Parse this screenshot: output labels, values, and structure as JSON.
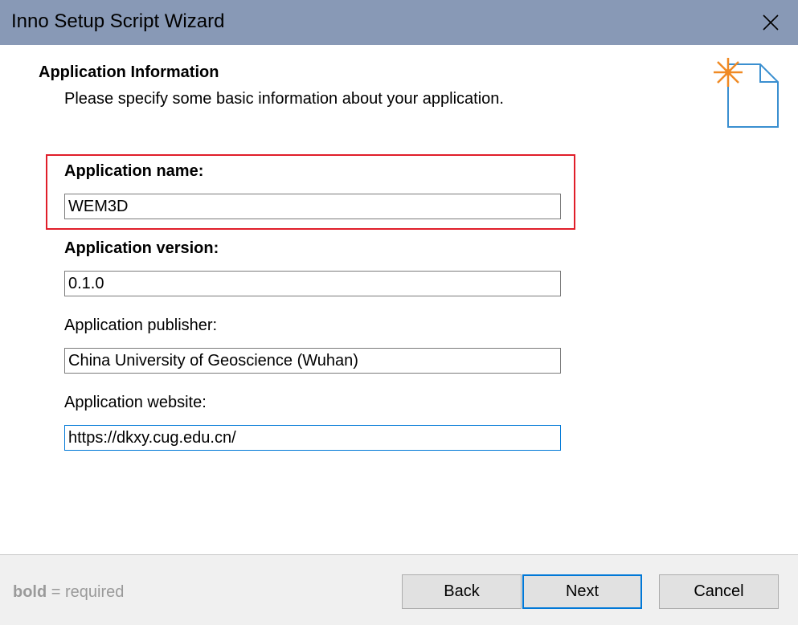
{
  "window": {
    "title": "Inno Setup Script Wizard"
  },
  "header": {
    "title": "Application Information",
    "subtitle": "Please specify some basic information about your application."
  },
  "form": {
    "name": {
      "label": "Application name:",
      "value": "WEM3D",
      "required": true
    },
    "version": {
      "label": "Application version:",
      "value": "0.1.0",
      "required": true
    },
    "publisher": {
      "label": "Application publisher:",
      "value": "China University of Geoscience (Wuhan)",
      "required": false
    },
    "website": {
      "label": "Application website:",
      "value": "https://dkxy.cug.edu.cn/",
      "required": false
    }
  },
  "footer": {
    "hint_bold": "bold",
    "hint_rest": " = required",
    "back_label": "Back",
    "next_label": "Next",
    "cancel_label": "Cancel"
  },
  "colors": {
    "titlebar": "#8899b6",
    "highlight_border": "#e01e2a",
    "focus_border": "#0078d7",
    "icon_star": "#f08a24",
    "icon_page": "#3a8fd0"
  },
  "icons": [
    "close-icon",
    "wizard-new-document-icon"
  ]
}
